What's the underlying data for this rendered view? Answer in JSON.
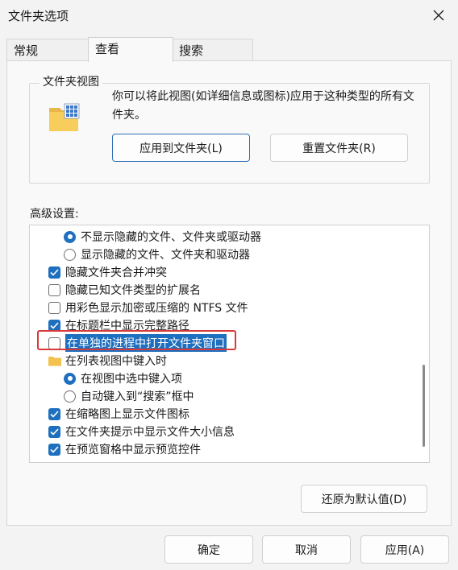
{
  "window": {
    "title": "文件夹选项"
  },
  "tabs": [
    {
      "label": "常规",
      "active": false
    },
    {
      "label": "查看",
      "active": true
    },
    {
      "label": "搜索",
      "active": false
    }
  ],
  "folder_view": {
    "title": "文件夹视图",
    "description": "你可以将此视图(如详细信息或图标)应用于这种类型的所有文件夹。",
    "apply_button": "应用到文件夹(L)",
    "reset_button": "重置文件夹(R)"
  },
  "advanced": {
    "label": "高级设置:",
    "items": [
      {
        "type": "radio",
        "checked": true,
        "label": "不显示隐藏的文件、文件夹或驱动器"
      },
      {
        "type": "radio",
        "checked": false,
        "label": "显示隐藏的文件、文件夹和驱动器"
      },
      {
        "type": "checkbox",
        "checked": true,
        "label": "隐藏文件夹合并冲突"
      },
      {
        "type": "checkbox",
        "checked": false,
        "label": "隐藏已知文件类型的扩展名"
      },
      {
        "type": "checkbox",
        "checked": false,
        "label": "用彩色显示加密或压缩的 NTFS 文件"
      },
      {
        "type": "checkbox",
        "checked": true,
        "label": "在标题栏中显示完整路径"
      },
      {
        "type": "checkbox",
        "checked": false,
        "selected": true,
        "label": "在单独的进程中打开文件夹窗口"
      },
      {
        "type": "folder",
        "label": "在列表视图中键入时"
      },
      {
        "type": "radio",
        "checked": true,
        "label": "在视图中选中键入项"
      },
      {
        "type": "radio",
        "checked": false,
        "label": "自动键入到“搜索”框中"
      },
      {
        "type": "checkbox",
        "checked": true,
        "label": "在缩略图上显示文件图标"
      },
      {
        "type": "checkbox",
        "checked": true,
        "label": "在文件夹提示中显示文件大小信息"
      },
      {
        "type": "checkbox",
        "checked": true,
        "label": "在预览窗格中显示预览控件"
      }
    ],
    "restore_button": "还原为默认值(D)"
  },
  "footer": {
    "ok": "确定",
    "cancel": "取消",
    "apply": "应用(A)"
  },
  "colors": {
    "accent": "#1f6fbf",
    "highlight_border": "#d83a3a"
  }
}
